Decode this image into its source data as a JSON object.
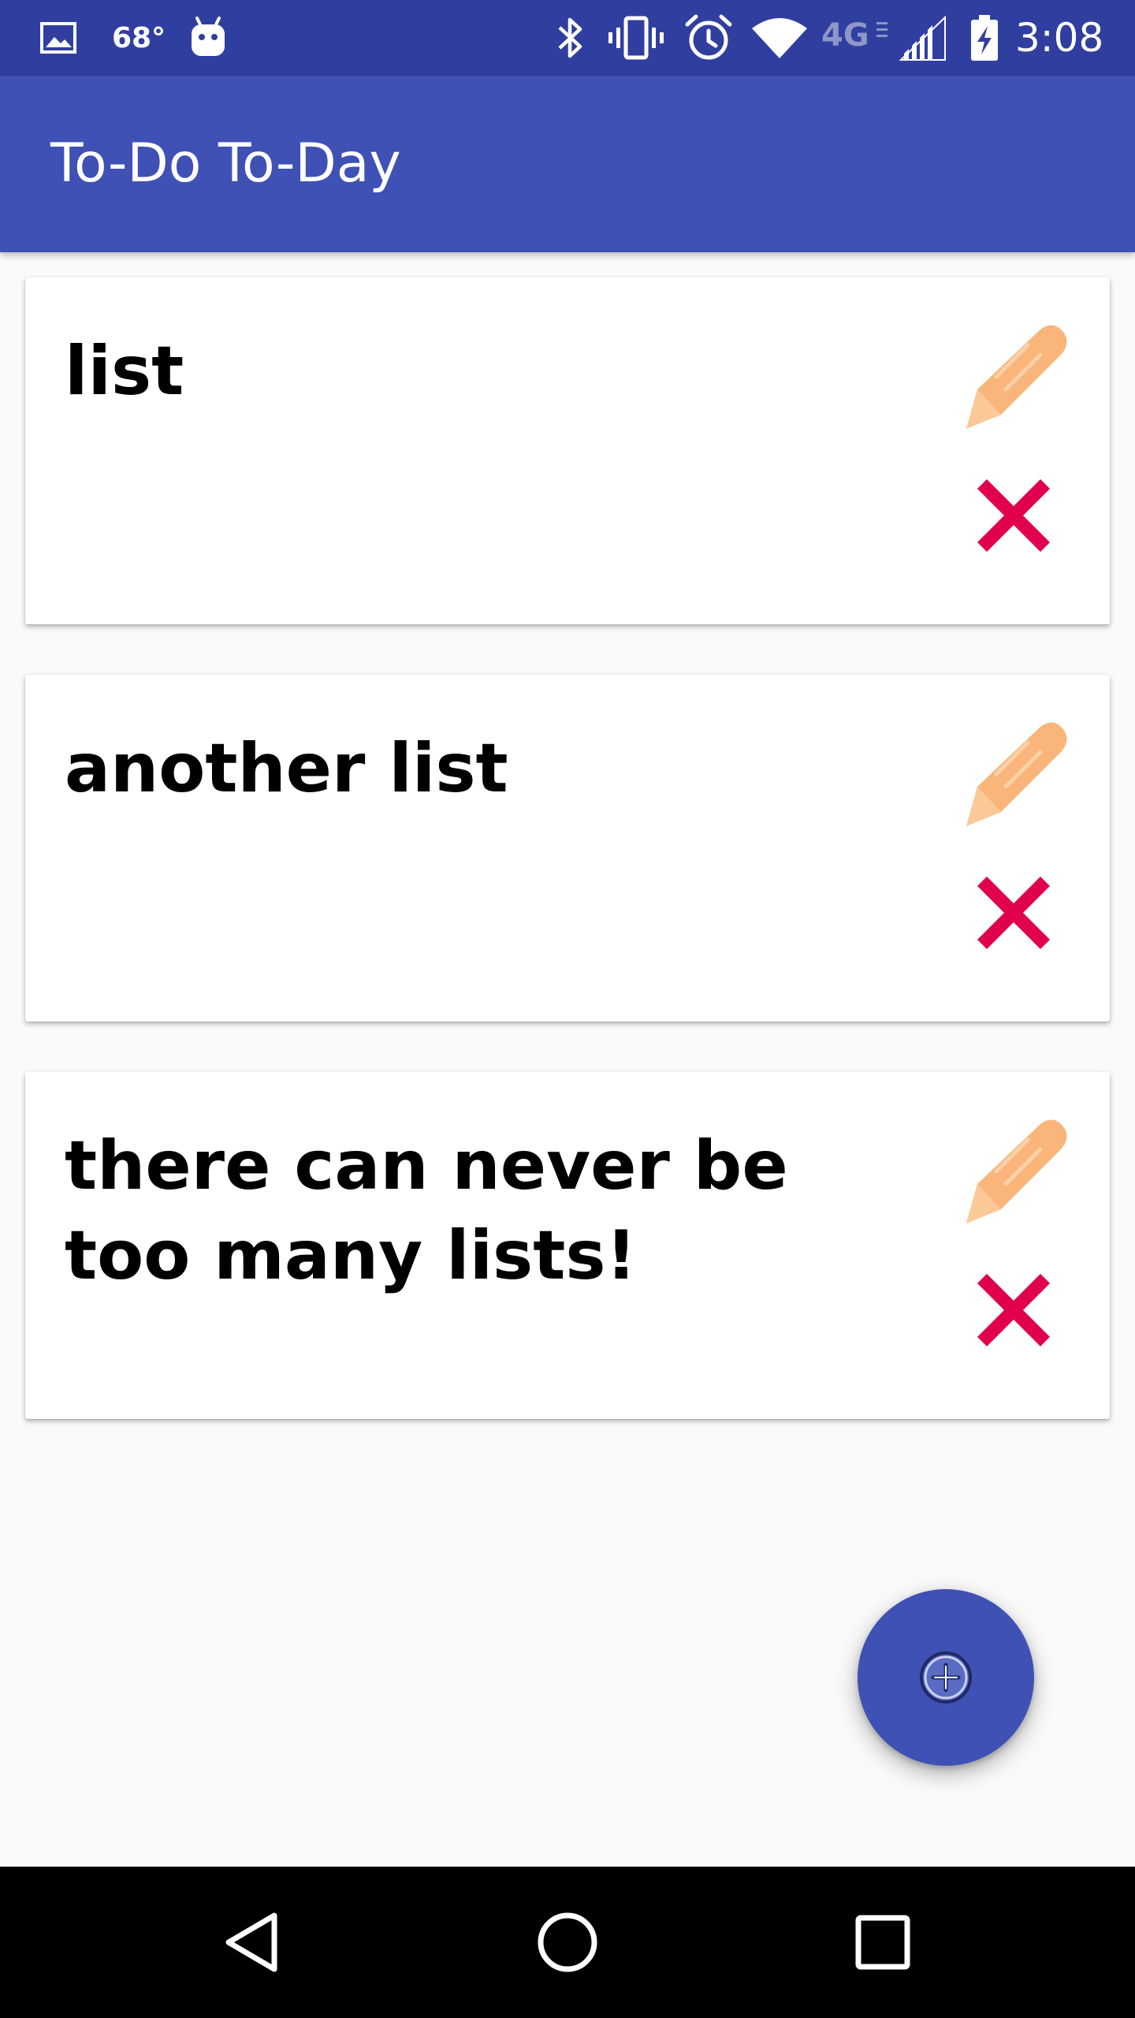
{
  "status_bar": {
    "temperature": "68°",
    "network_label": "4G",
    "time": "3:08",
    "left_icons": [
      "image-icon",
      "android-icon"
    ],
    "right_icons": [
      "bluetooth-icon",
      "vibrate-icon",
      "alarm-icon",
      "wifi-icon",
      "lte-icon",
      "signal-icon",
      "battery-charging-icon"
    ],
    "background_color": "#303f9f"
  },
  "app_bar": {
    "title": "To-Do To-Day",
    "background_color": "#3f51b5"
  },
  "lists": [
    {
      "title": "list",
      "edit_icon": "pencil-icon",
      "delete_icon": "delete-x-icon"
    },
    {
      "title": "another list",
      "edit_icon": "pencil-icon",
      "delete_icon": "delete-x-icon"
    },
    {
      "title": "there can never be too many lists!",
      "edit_icon": "pencil-icon",
      "delete_icon": "delete-x-icon"
    }
  ],
  "fab": {
    "icon": "add-circle-icon",
    "background_color": "#3f51b5"
  },
  "nav_bar": {
    "buttons": [
      "back-icon",
      "home-icon",
      "recents-icon"
    ],
    "background_color": "#000000"
  },
  "colors": {
    "edit_icon": "#f9b57a",
    "delete_icon": "#e0004d",
    "card_background": "#ffffff",
    "page_background": "#fafafa"
  }
}
